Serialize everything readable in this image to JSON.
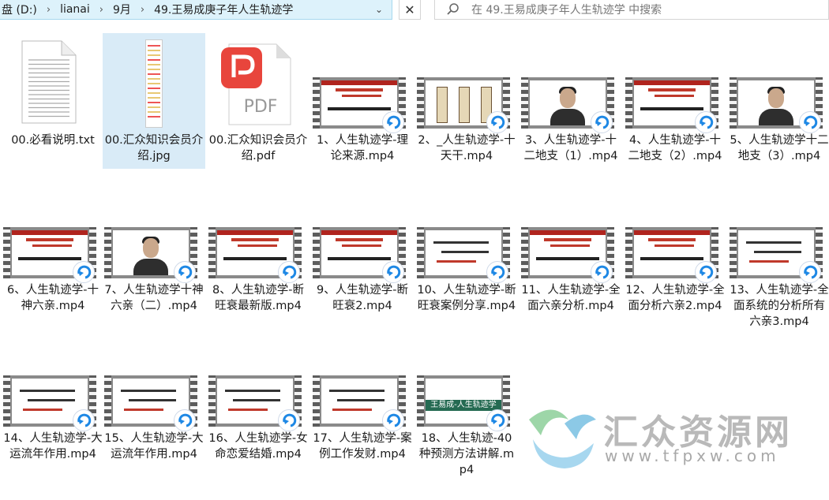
{
  "address_bar": {
    "crumbs": [
      "盘 (D:)",
      "lianai",
      "9月",
      "49.王易成庚子年人生轨迹学"
    ]
  },
  "search": {
    "placeholder": "在 49.王易成庚子年人生轨迹学 中搜索"
  },
  "files": [
    {
      "name": "00.必看说明.txt",
      "type": "txt"
    },
    {
      "name": "00.汇众知识会员介绍.jpg",
      "type": "jpg",
      "selected": true
    },
    {
      "name": "00.汇众知识会员介绍.pdf",
      "type": "pdf"
    },
    {
      "name": "1、人生轨迹学-理论来源.mp4",
      "type": "video",
      "thumb": "slide-red"
    },
    {
      "name": "2、_人生轨迹学-十天干.mp4",
      "type": "video",
      "thumb": "scroll"
    },
    {
      "name": "3、人生轨迹学-十二地支（1）.mp4",
      "type": "video",
      "thumb": "person"
    },
    {
      "name": "4、人生轨迹学-十二地支（2）.mp4",
      "type": "video",
      "thumb": "slide-red"
    },
    {
      "name": "5、人生轨迹学十二地支（3）.mp4",
      "type": "video",
      "thumb": "person"
    },
    {
      "name": "6、人生轨迹学-十神六亲.mp4",
      "type": "video",
      "thumb": "slide-red"
    },
    {
      "name": "7、人生轨迹学十神六亲（二）.mp4",
      "type": "video",
      "thumb": "person"
    },
    {
      "name": "8、人生轨迹学-断旺衰最新版.mp4",
      "type": "video",
      "thumb": "slide-red"
    },
    {
      "name": "9、人生轨迹学-断旺衰2.mp4",
      "type": "video",
      "thumb": "slide-red"
    },
    {
      "name": "10、人生轨迹学-断旺衰案例分享.mp4",
      "type": "video",
      "thumb": "ink"
    },
    {
      "name": "11、人生轨迹学-全面六亲分析.mp4",
      "type": "video",
      "thumb": "slide-red"
    },
    {
      "name": "12、人生轨迹学-全面分析六亲2.mp4",
      "type": "video",
      "thumb": "slide-red"
    },
    {
      "name": "13、人生轨迹学-全面系统的分析所有六亲3.mp4",
      "type": "video",
      "thumb": "ink"
    },
    {
      "name": "14、人生轨迹学-大运流年作用.mp4",
      "type": "video",
      "thumb": "ink"
    },
    {
      "name": "15、人生轨迹学-大运流年作用.mp4",
      "type": "video",
      "thumb": "ink"
    },
    {
      "name": "16、人生轨迹学-女命恋爱结婚.mp4",
      "type": "video",
      "thumb": "ink"
    },
    {
      "name": "17、人生轨迹学-案例工作发财.mp4",
      "type": "video",
      "thumb": "ink"
    },
    {
      "name": "18、人生轨迹-40种预测方法讲解.mp4",
      "type": "video",
      "thumb": "green",
      "thumb_text": "王易成-人生轨迹学"
    }
  ],
  "pdf_icon_text": "PDF",
  "watermark": {
    "text": "汇众资源网",
    "url": "www.tfpxw.com"
  }
}
